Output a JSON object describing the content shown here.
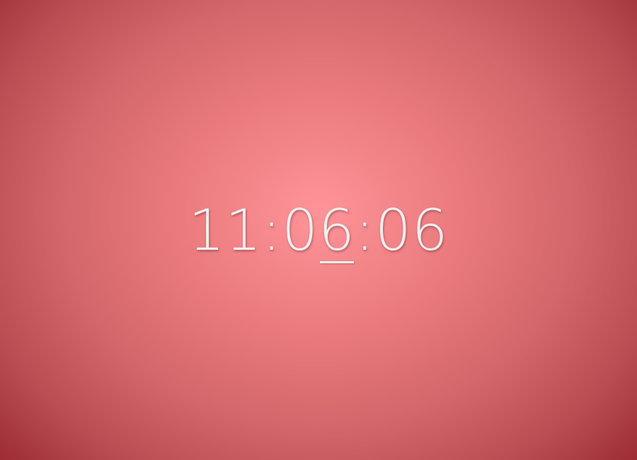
{
  "colors": {
    "background_center": "#ff9498",
    "background_edge": "#9c2a33",
    "clock_text": "#efefef"
  },
  "clock": {
    "hours": "11",
    "separator_1": ":",
    "minutes_tens": "0",
    "minutes_ones": "6",
    "separator_2": ":",
    "seconds": "06"
  }
}
